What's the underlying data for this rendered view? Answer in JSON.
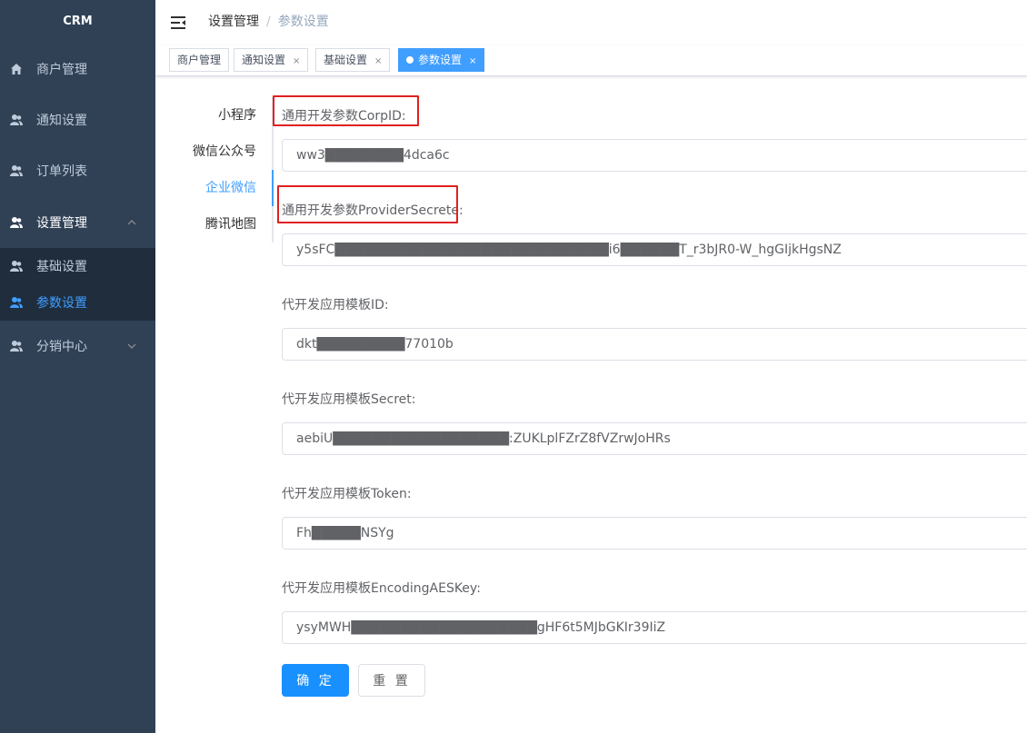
{
  "app": {
    "logo": "CRM"
  },
  "sidebar": {
    "items": [
      {
        "label": "商户管理",
        "icon": "home-icon"
      },
      {
        "label": "通知设置",
        "icon": "user-group-icon"
      },
      {
        "label": "订单列表",
        "icon": "user-group-icon"
      },
      {
        "label": "设置管理",
        "icon": "user-group-icon",
        "expanded": true,
        "children": [
          {
            "label": "基础设置",
            "icon": "user-group-icon"
          },
          {
            "label": "参数设置",
            "icon": "user-group-icon",
            "active": true
          }
        ]
      },
      {
        "label": "分销中心",
        "icon": "user-group-icon",
        "expanded": false
      }
    ]
  },
  "breadcrumb": {
    "items": [
      "设置管理",
      "参数设置"
    ],
    "separator": "/"
  },
  "tags": [
    {
      "label": "商户管理",
      "closable": false
    },
    {
      "label": "通知设置",
      "closable": true
    },
    {
      "label": "基础设置",
      "closable": true
    },
    {
      "label": "参数设置",
      "closable": true,
      "active": true
    }
  ],
  "tag_close_glyph": "×",
  "vtabs": [
    "小程序",
    "微信公众号",
    "企业微信",
    "腾讯地图"
  ],
  "vtabs_active": "企业微信",
  "form": {
    "fields": [
      {
        "label": "通用开发参数CorpID:",
        "value": "ww3████████4dca6c",
        "highlighted": true
      },
      {
        "label": "通用开发参数ProviderSecrete:",
        "value": "y5sFC████████████████████████████i6██████T_r3bJR0-W_hgGIjkHgsNZ",
        "highlighted": true
      },
      {
        "label": "代开发应用模板ID:",
        "value": "dkt█████████77010b",
        "highlighted": false
      },
      {
        "label": "代开发应用模板Secret:",
        "value": "aebiU██████████████████:ZUKLplFZrZ8fVZrwJoHRs",
        "highlighted": false
      },
      {
        "label": "代开发应用模板Token:",
        "value": "Fh█████NSYg",
        "highlighted": false
      },
      {
        "label": "代开发应用模板EncodingAESKey:",
        "value": "ysyMWH███████████████████gHF6t5MJbGKIr39IiZ",
        "highlighted": false
      }
    ],
    "submit_label": "确 定",
    "reset_label": "重 置"
  },
  "colors": {
    "sidebar_bg": "#304156",
    "submenu_bg": "#1f2d3d",
    "accent": "#409eff",
    "primary_button": "#1890ff",
    "highlight_box": "#e02020"
  }
}
